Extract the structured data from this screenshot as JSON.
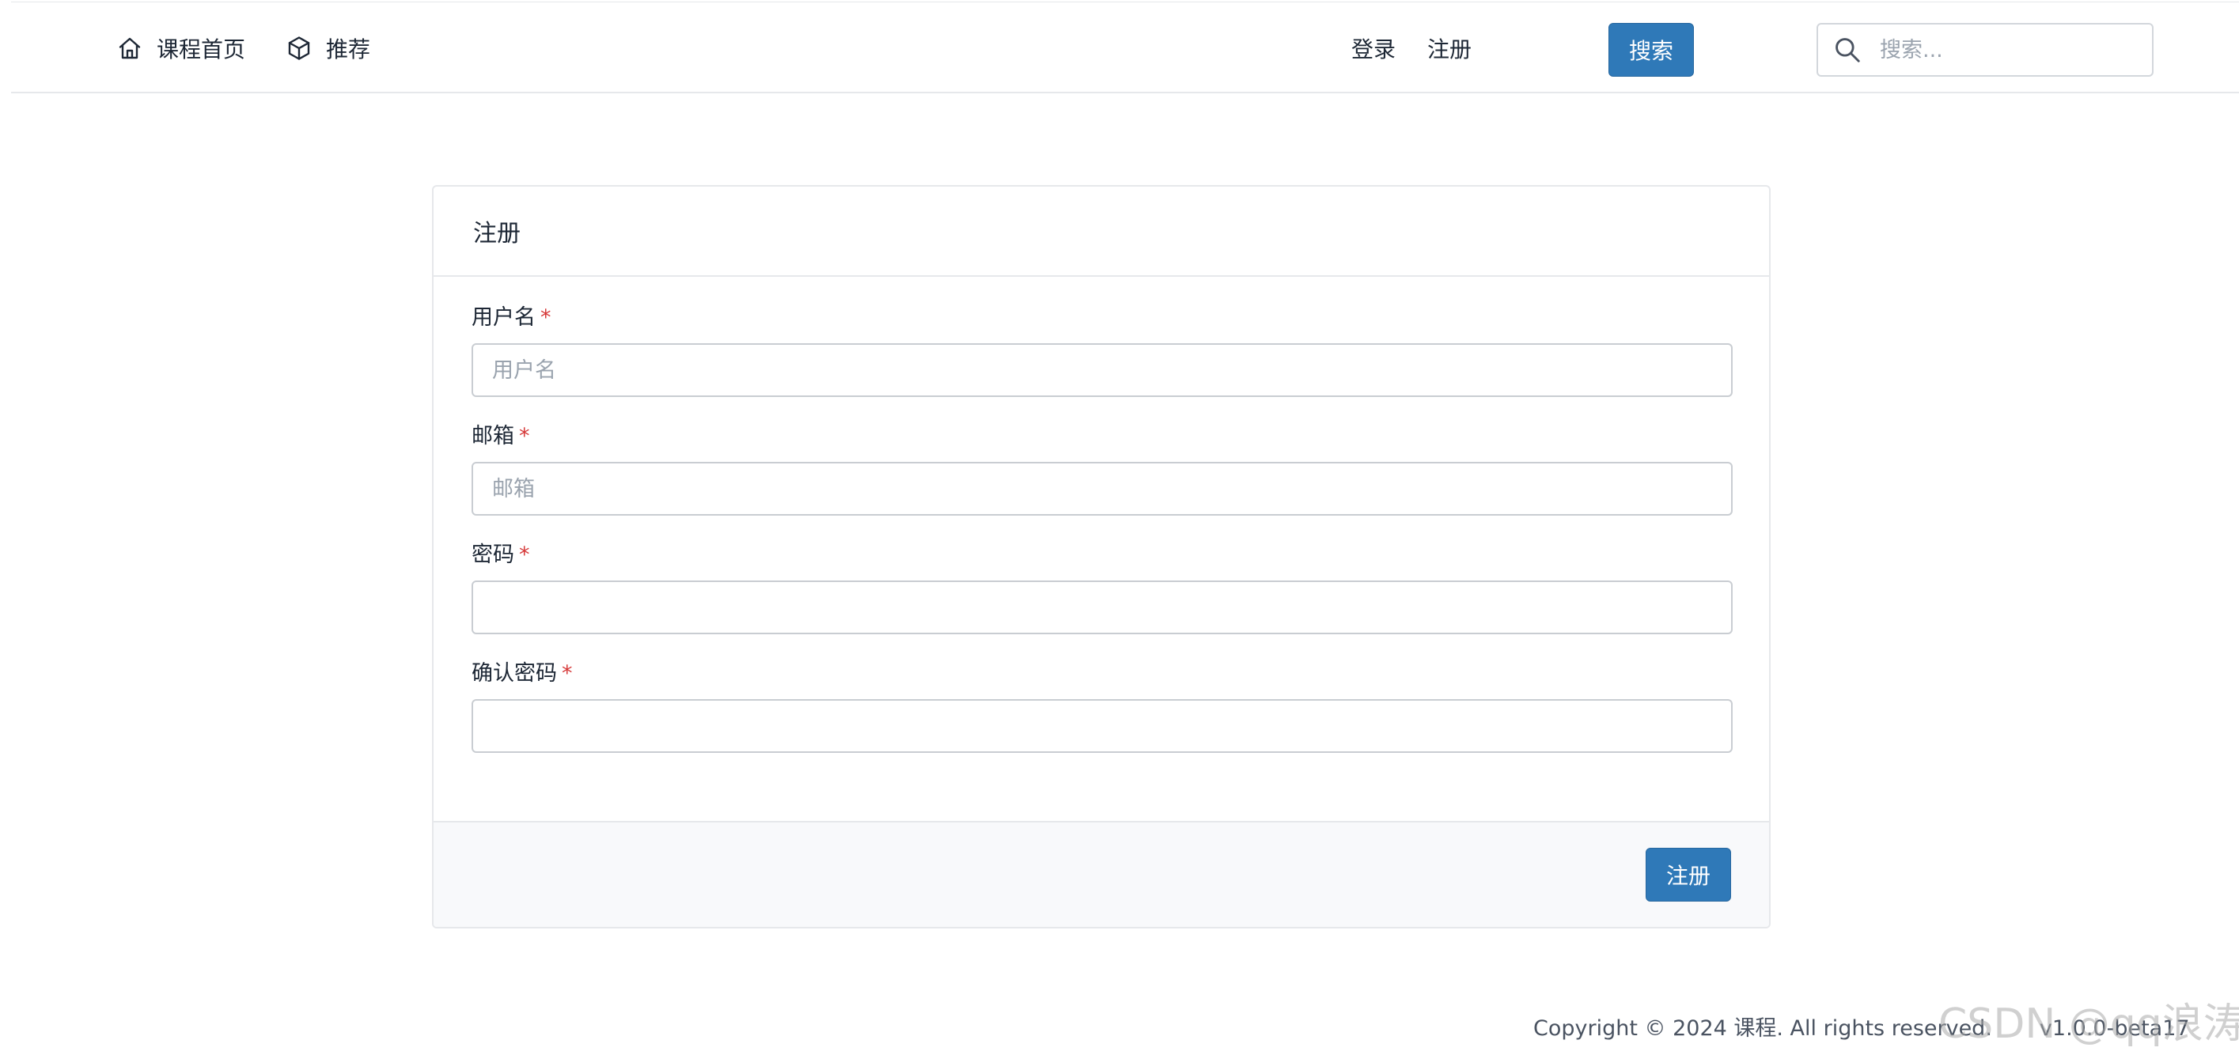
{
  "nav": {
    "home_label": "课程首页",
    "recommend_label": "推荐",
    "login_label": "登录",
    "register_label": "注册",
    "search_button_label": "搜索",
    "search_placeholder": "搜索..."
  },
  "form": {
    "title": "注册",
    "required_marker": "*",
    "fields": [
      {
        "label": "用户名",
        "placeholder": "用户名",
        "value": ""
      },
      {
        "label": "邮箱",
        "placeholder": "邮箱",
        "value": ""
      },
      {
        "label": "密码",
        "placeholder": "",
        "value": ""
      },
      {
        "label": "确认密码",
        "placeholder": "",
        "value": ""
      }
    ],
    "submit_label": "注册"
  },
  "footer": {
    "copyright": "Copyright © 2024 课程. All rights reserved.",
    "version": "v1.0.0-beta17"
  },
  "watermark": "CSDN @qq浪涛",
  "colors": {
    "primary": "#2f79b8",
    "required": "#d63939",
    "border": "#e6e8eb",
    "footer_bg": "#f8f9fb"
  }
}
